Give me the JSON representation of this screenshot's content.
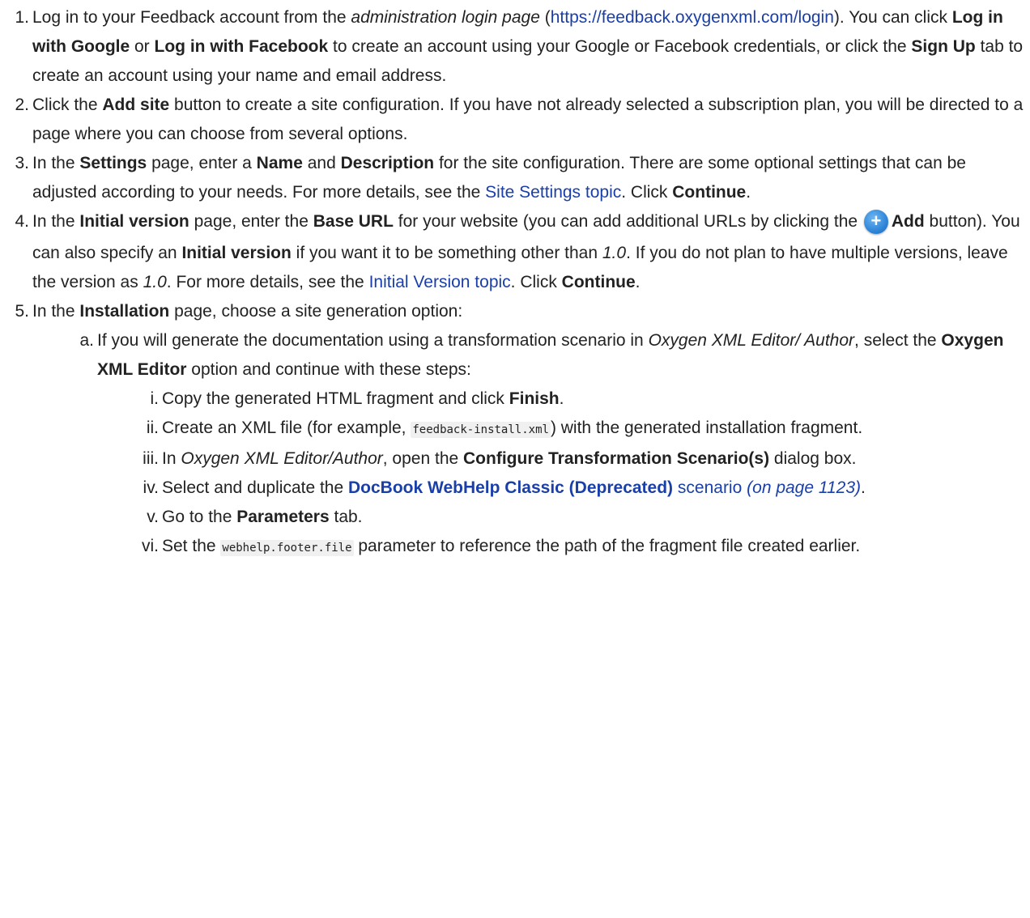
{
  "steps": [
    {
      "num": "1.",
      "parts": {
        "t1": "Log in to your Feedback account from the ",
        "e1": "administration login page",
        "t2": " (",
        "link": "https://feedback.oxygenxml.com/login",
        "t3": "). You can click ",
        "b1": "Log in with Google",
        "t4": " or ",
        "b2": "Log in with Facebook",
        "t5": " to create an account using your Google or Facebook credentials, or click the ",
        "b3": "Sign Up",
        "t6": " tab to create an account using your name and email address."
      }
    },
    {
      "num": "2.",
      "parts": {
        "t1": "Click the ",
        "b1": "Add site",
        "t2": " button to create a site configuration. If you have not already selected a subscription plan, you will be directed to a page where you can choose from several options."
      }
    },
    {
      "num": "3.",
      "parts": {
        "t1": "In the ",
        "b1": "Settings",
        "t2": " page, enter a ",
        "b2": "Name",
        "t3": " and ",
        "b3": "Description",
        "t4": " for the site configuration. There are some optional settings that can be adjusted according to your needs. For more details, see the ",
        "link": "Site Settings topic",
        "t5": ". Click ",
        "b4": "Continue",
        "t6": "."
      }
    },
    {
      "num": "4.",
      "parts": {
        "t1": "In the ",
        "b1": "Initial version",
        "t2": " page, enter the ",
        "b2": "Base URL",
        "t3": " for your website (you can add additional URLs by clicking the ",
        "icon": "add-icon",
        "b3": "Add",
        "t4": " button). You can also specify an ",
        "b4": "Initial version",
        "t5": " if you want it to be something other than ",
        "e1": "1.0",
        "t6": ". If you do not plan to have multiple versions, leave the version as ",
        "e2": "1.0",
        "t7": ". For more details, see the ",
        "link": "Initial Version topic",
        "t8": ". Click ",
        "b5": "Continue",
        "t9": "."
      }
    },
    {
      "num": "5.",
      "parts": {
        "t1": "In the ",
        "b1": "Installation",
        "t2": " page, choose a site generation option:"
      },
      "sub": {
        "num": "a.",
        "t1": "If you will generate the documentation using a transformation scenario in ",
        "e1": "Oxygen XML Editor/ Author",
        "t2": ", select the ",
        "b1": "Oxygen XML Editor",
        "t3": " option and continue with these steps:",
        "items": [
          {
            "num": "i.",
            "t1": "Copy the generated HTML fragment and click ",
            "b1": "Finish",
            "t2": "."
          },
          {
            "num": "ii.",
            "t1": "Create an XML file (for example, ",
            "code": "feedback-install.xml",
            "t2": ") with the generated installation fragment."
          },
          {
            "num": "iii.",
            "t1": "In ",
            "e1": "Oxygen XML Editor/Author",
            "t2": ", open the ",
            "b1": "Configure Transformation Scenario(s)",
            "t3": " dialog box."
          },
          {
            "num": "iv.",
            "t1": "Select and duplicate the ",
            "link": "DocBook WebHelp Classic (Deprecated)",
            "link2": "scenario",
            "xref": "(on page 1123)",
            "t2": "."
          },
          {
            "num": "v.",
            "t1": "Go to the ",
            "b1": "Parameters",
            "t2": " tab."
          },
          {
            "num": "vi.",
            "t1": "Set the ",
            "code": "webhelp.footer.file",
            "t2": " parameter to reference the path of the fragment file created earlier."
          }
        ]
      }
    }
  ],
  "colors": {
    "link": "#1a3fa8",
    "text": "#222222",
    "code_bg": "#f0f0f0",
    "icon": "#2f86d8"
  }
}
